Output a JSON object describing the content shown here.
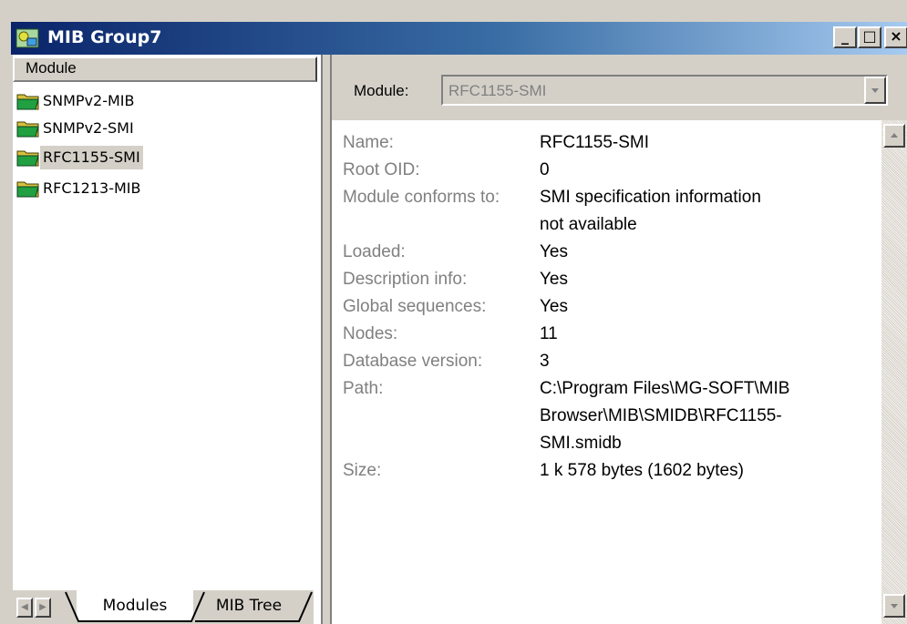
{
  "window": {
    "title": "MIB Group7",
    "buttons": {
      "minimize": "_",
      "maximize": "□",
      "close": "×"
    }
  },
  "left_pane": {
    "column_header": "Module",
    "modules": [
      {
        "label": "SNMPv2-MIB",
        "icon": "folder-icon",
        "selected": false
      },
      {
        "label": "SNMPv2-SMI",
        "icon": "folder-icon",
        "selected": false
      },
      {
        "label": "RFC1155-SMI",
        "icon": "folder-icon",
        "selected": true
      },
      {
        "label": "RFC1213-MIB",
        "icon": "folder-icon",
        "selected": false
      }
    ],
    "tabs": [
      {
        "label": "Modules",
        "active": true
      },
      {
        "label": "MIB Tree",
        "active": false
      }
    ]
  },
  "right_pane": {
    "module_label": "Module:",
    "module_value": "RFC1155-SMI",
    "info": {
      "name_key": "Name:",
      "name_val": "RFC1155-SMI",
      "root_oid_key": "Root OID:",
      "root_oid_val": "0",
      "conforms_key": "Module conforms to:",
      "conforms_val_1": "SMI specification information",
      "conforms_val_2": "not available",
      "loaded_key": "Loaded:",
      "loaded_val": "Yes",
      "desc_key": "Description info:",
      "desc_val": "Yes",
      "global_key": "Global sequences:",
      "global_val": "Yes",
      "nodes_key": "Nodes:",
      "nodes_val": "11",
      "dbver_key": "Database version:",
      "dbver_val": "3",
      "path_key": "Path:",
      "path_val_1": "C:\\Program Files\\MG-SOFT\\MIB",
      "path_val_2": "Browser\\MIB\\SMIDB\\RFC1155-",
      "path_val_3": "SMI.smidb",
      "size_key": "Size:",
      "size_val": "1 k 578 bytes (1602 bytes)"
    }
  },
  "colors": {
    "titlebar_start": "#0a246a",
    "titlebar_end": "#a6caf0",
    "face": "#d4d0c8",
    "key_text": "#808080"
  }
}
